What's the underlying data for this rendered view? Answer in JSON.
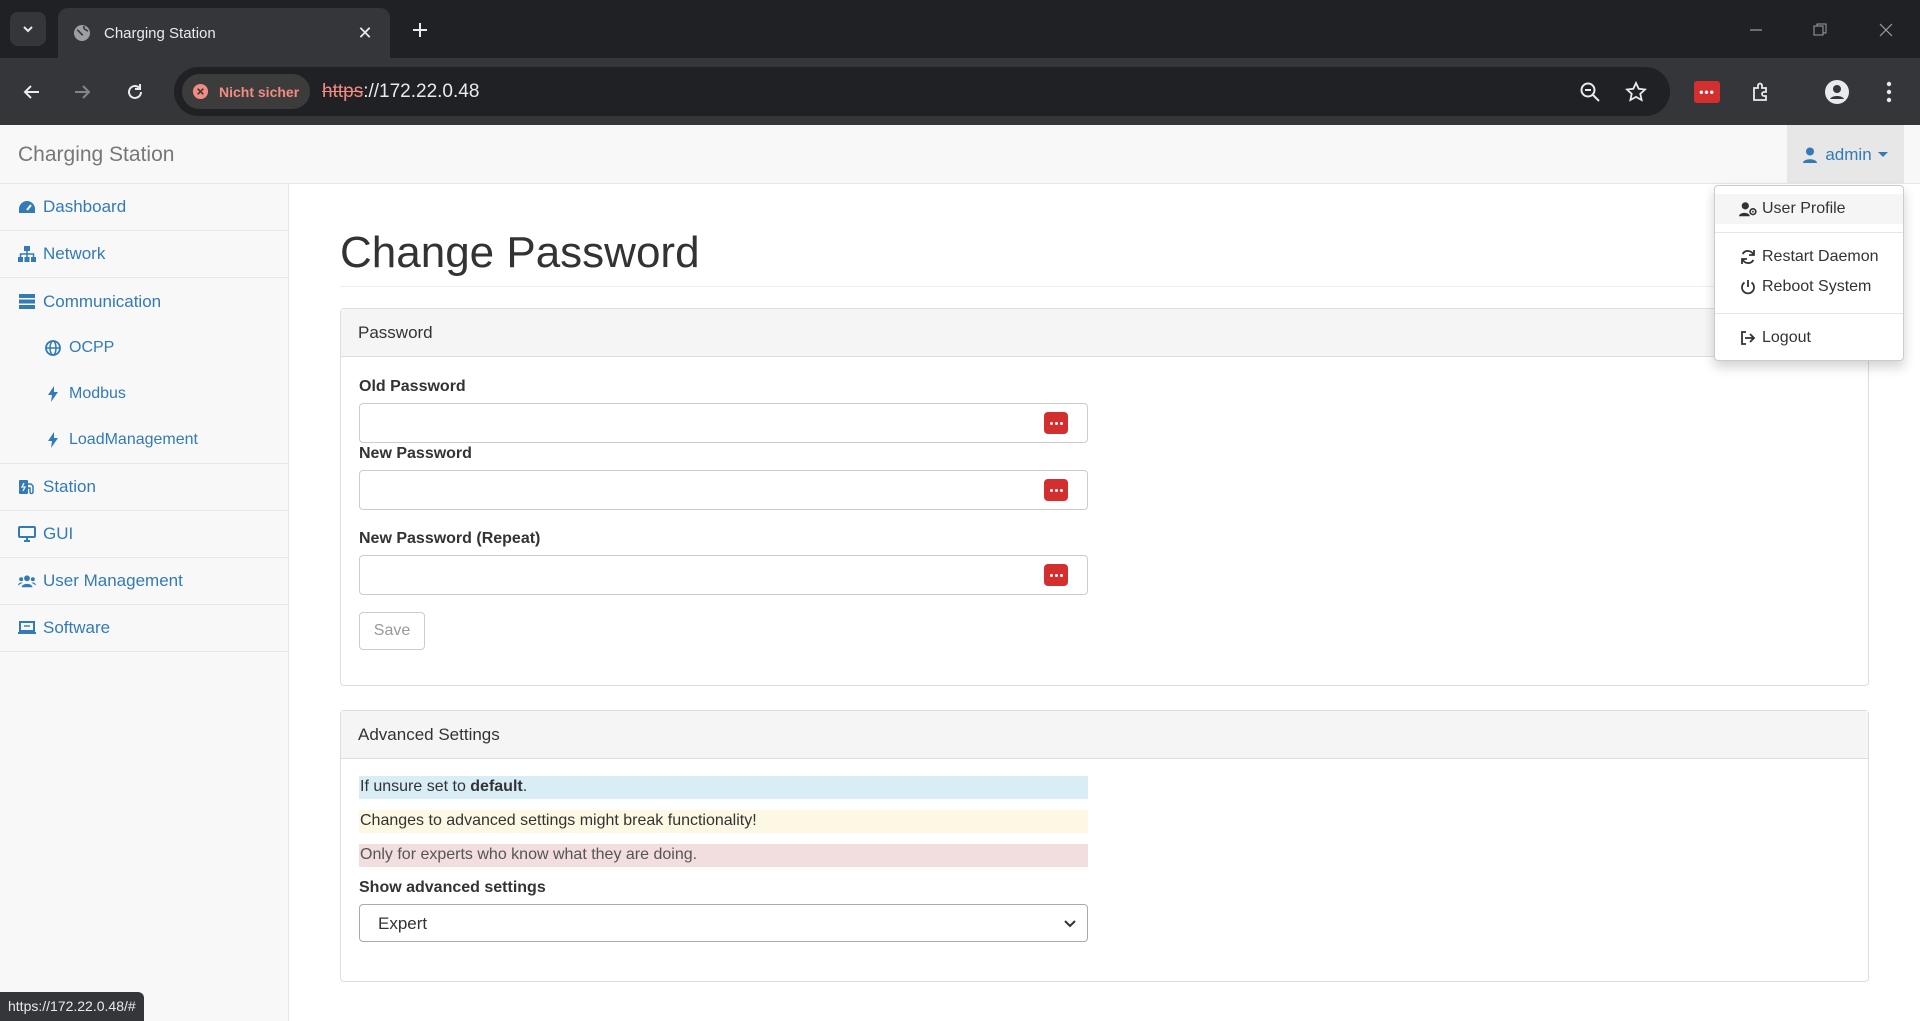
{
  "browser": {
    "tab_title": "Charging Station",
    "security_label": "Nicht sicher",
    "url_scheme": "https",
    "url_rest": "://172.22.0.48",
    "status_url": "https://172.22.0.48/#"
  },
  "header": {
    "brand": "Charging Station",
    "user": "admin"
  },
  "sidebar": {
    "items": [
      {
        "label": "Dashboard",
        "icon": "dashboard-icon"
      },
      {
        "label": "Network",
        "icon": "sitemap-icon"
      },
      {
        "label": "Communication",
        "icon": "server-icon"
      },
      {
        "label": "OCPP",
        "icon": "globe-icon"
      },
      {
        "label": "Modbus",
        "icon": "bolt-icon"
      },
      {
        "label": "LoadManagement",
        "icon": "bolt-icon"
      },
      {
        "label": "Station",
        "icon": "charging-station-icon"
      },
      {
        "label": "GUI",
        "icon": "desktop-icon"
      },
      {
        "label": "User Management",
        "icon": "users-icon"
      },
      {
        "label": "Software",
        "icon": "laptop-icon"
      }
    ]
  },
  "main": {
    "title": "Change Password",
    "password_panel": {
      "heading": "Password",
      "old_label": "Old Password",
      "new_label": "New Password",
      "repeat_label": "New Password (Repeat)",
      "save_label": "Save"
    },
    "advanced_panel": {
      "heading": "Advanced Settings",
      "info_prefix": "If unsure set to ",
      "info_bold": "default",
      "info_suffix": ".",
      "warning": "Changes to advanced settings might break functionality!",
      "danger": "Only for experts who know what they are doing.",
      "select_label": "Show advanced settings",
      "select_value": "Expert"
    }
  },
  "dropdown": {
    "items": [
      "User Profile",
      "Restart Daemon",
      "Reboot System",
      "Logout"
    ]
  },
  "colors": {
    "link": "#337ab7",
    "chrome_dark": "#202124",
    "chrome_toolbar": "#35363a",
    "password_manager": "#d32f2f"
  }
}
